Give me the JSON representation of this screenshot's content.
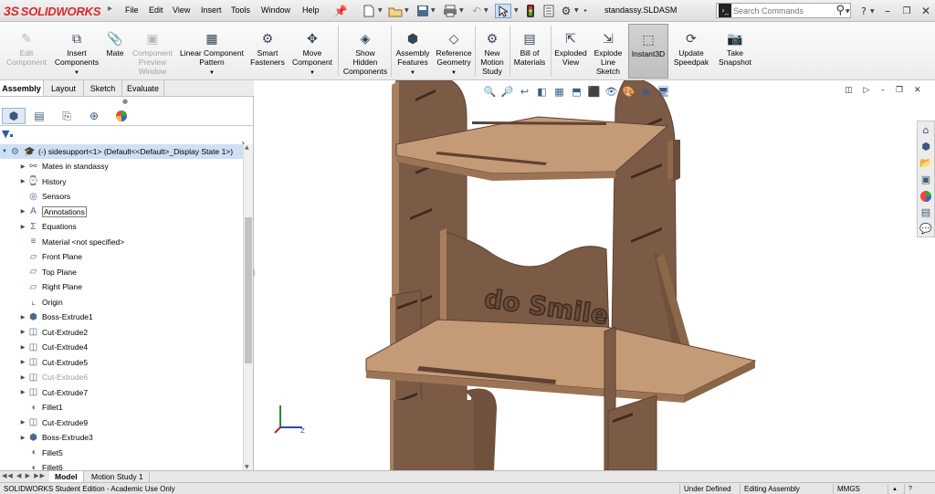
{
  "app": {
    "logo_text": "SOLIDWORKS",
    "logo_prefix": "3S",
    "document_title": "standassy.SLDASM"
  },
  "menu": [
    "File",
    "Edit",
    "View",
    "Insert",
    "Tools",
    "Window",
    "Help"
  ],
  "search": {
    "placeholder": "Search Commands"
  },
  "quick_toolbar_icons": [
    "new-icon",
    "open-icon",
    "save-icon",
    "print-icon",
    "undo-icon",
    "select-icon",
    "rebuild-icon",
    "file-properties-icon",
    "options-icon"
  ],
  "command_manager": [
    {
      "label": "Edit\nComponent",
      "icon": "edit-component-icon",
      "enabled": false
    },
    {
      "label": "Insert\nComponents",
      "icon": "insert-components-icon",
      "enabled": true
    },
    {
      "label": "Mate",
      "icon": "mate-icon",
      "enabled": true
    },
    {
      "label": "Component\nPreview\nWindow",
      "icon": "component-preview-icon",
      "enabled": false
    },
    {
      "label": "Linear Component\nPattern",
      "icon": "linear-pattern-icon",
      "enabled": true
    },
    {
      "label": "Smart\nFasteners",
      "icon": "smart-fasteners-icon",
      "enabled": true
    },
    {
      "label": "Move\nComponent",
      "icon": "move-component-icon",
      "enabled": true
    },
    {
      "label": "Show\nHidden\nComponents",
      "icon": "show-hidden-icon",
      "enabled": true
    },
    {
      "label": "Assembly\nFeatures",
      "icon": "assembly-features-icon",
      "enabled": true
    },
    {
      "label": "Reference\nGeometry",
      "icon": "reference-geometry-icon",
      "enabled": true
    },
    {
      "label": "New\nMotion\nStudy",
      "icon": "motion-study-icon",
      "enabled": true
    },
    {
      "label": "Bill of\nMaterials",
      "icon": "bom-icon",
      "enabled": true
    },
    {
      "label": "Exploded\nView",
      "icon": "exploded-view-icon",
      "enabled": true
    },
    {
      "label": "Explode\nLine\nSketch",
      "icon": "explode-line-icon",
      "enabled": true
    },
    {
      "label": "Instant3D",
      "icon": "instant3d-icon",
      "enabled": true
    },
    {
      "label": "Update\nSpeedpak",
      "icon": "speedpak-icon",
      "enabled": true
    },
    {
      "label": "Take\nSnapshot",
      "icon": "snapshot-icon",
      "enabled": true
    }
  ],
  "panel_tabs": [
    "Assembly",
    "Layout",
    "Sketch",
    "Evaluate"
  ],
  "feature_tree": {
    "root": "(-) sidesupport<1> (Default<<Default>_Display State 1>)",
    "items": [
      {
        "label": "Mates in standassy",
        "expandable": true,
        "icon": "mates-icon"
      },
      {
        "label": "History",
        "expandable": true,
        "icon": "history-icon"
      },
      {
        "label": "Sensors",
        "expandable": false,
        "icon": "sensors-icon"
      },
      {
        "label": "Annotations",
        "expandable": true,
        "icon": "annotations-icon"
      },
      {
        "label": "Equations",
        "expandable": true,
        "icon": "equations-icon"
      },
      {
        "label": "Material <not specified>",
        "expandable": false,
        "icon": "material-icon"
      },
      {
        "label": "Front Plane",
        "expandable": false,
        "icon": "plane-icon"
      },
      {
        "label": "Top Plane",
        "expandable": false,
        "icon": "plane-icon"
      },
      {
        "label": "Right Plane",
        "expandable": false,
        "icon": "plane-icon"
      },
      {
        "label": "Origin",
        "expandable": false,
        "icon": "origin-icon"
      },
      {
        "label": "Boss-Extrude1",
        "expandable": true,
        "icon": "boss-extrude-icon"
      },
      {
        "label": "Cut-Extrude2",
        "expandable": true,
        "icon": "cut-extrude-icon"
      },
      {
        "label": "Cut-Extrude4",
        "expandable": true,
        "icon": "cut-extrude-icon"
      },
      {
        "label": "Cut-Extrude5",
        "expandable": true,
        "icon": "cut-extrude-icon"
      },
      {
        "label": "Cut-Extrude6",
        "expandable": true,
        "icon": "cut-extrude-icon"
      },
      {
        "label": "Cut-Extrude7",
        "expandable": true,
        "icon": "cut-extrude-icon"
      },
      {
        "label": "Fillet1",
        "expandable": false,
        "icon": "fillet-icon"
      },
      {
        "label": "Cut-Extrude9",
        "expandable": true,
        "icon": "cut-extrude-icon"
      },
      {
        "label": "Boss-Extrude3",
        "expandable": true,
        "icon": "boss-extrude-icon"
      },
      {
        "label": "Fillet5",
        "expandable": false,
        "icon": "fillet-icon"
      },
      {
        "label": "Fillet6",
        "expandable": false,
        "icon": "fillet-icon"
      }
    ]
  },
  "bottom_tabs": [
    "Model",
    "Motion Study 1"
  ],
  "status_bar": {
    "edition": "SOLIDWORKS Student Edition - Academic Use Only",
    "state": "Under Defined",
    "mode": "Editing Assembly",
    "units": "MMGS"
  },
  "model": {
    "engraved_text": "do Smile"
  },
  "colors": {
    "wood_top": "#c59a76",
    "wood_side": "#7b5b45",
    "wood_edge": "#5e4232",
    "brand_red": "#d8282a",
    "tree_selection": "#cde0f5"
  }
}
